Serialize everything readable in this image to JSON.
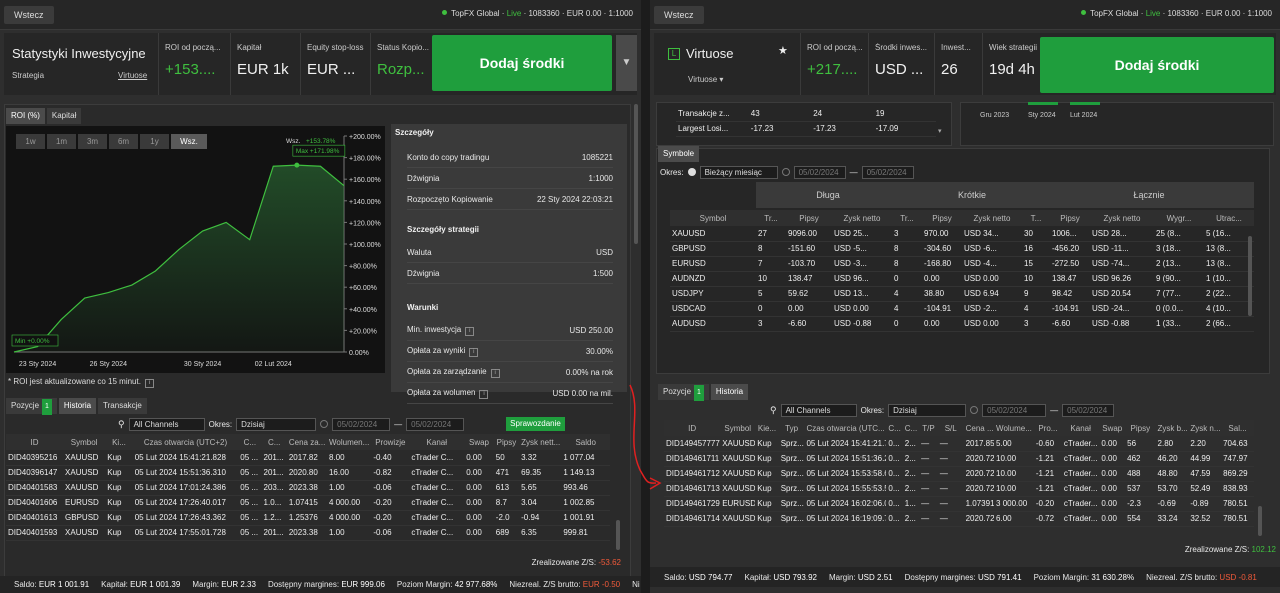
{
  "left": {
    "back_label": "Wstecz",
    "account": {
      "broker": "TopFX Global",
      "sep1": " · ",
      "live": "Live",
      "rest": " · 1083360 · EUR 0.00 · 1:1000"
    },
    "header": {
      "title": "Statystyki Inwestycyjne",
      "sub_label": "Strategia",
      "sub_value": "Virtuose",
      "kpis": [
        {
          "label": "ROI od począ...",
          "value": "+153...."
        },
        {
          "label": "Kapitał",
          "value": "EUR 1k"
        },
        {
          "label": "Equity stop-loss",
          "value": "EUR ..."
        },
        {
          "label": "Status Kopio...",
          "value": "Rozp..."
        }
      ],
      "add_funds": "Dodaj środki",
      "more_icon": "▼"
    },
    "chart_tabs": [
      "ROI (%)",
      "Kapitał"
    ],
    "periods": [
      "1w",
      "1m",
      "3m",
      "6m",
      "1y",
      "Wsz."
    ],
    "chart_data": {
      "type": "area",
      "x": [
        "2024-01-22",
        "2024-01-23",
        "2024-01-24",
        "2024-01-25",
        "2024-01-26",
        "2024-01-27",
        "2024-01-28",
        "2024-01-29",
        "2024-01-30",
        "2024-01-31",
        "2024-02-01",
        "2024-02-02",
        "2024-02-03",
        "2024-02-04",
        "2024-02-05"
      ],
      "values": [
        0,
        5,
        30,
        50,
        55,
        62,
        75,
        95,
        112,
        120,
        104,
        172,
        173,
        172,
        154
      ],
      "ylim": [
        0,
        200
      ],
      "yticks": [
        "+200.00%",
        "+180.00%",
        "+160.00%",
        "+140.00%",
        "+120.00%",
        "+100.00%",
        "+80.00%",
        "+60.00%",
        "+40.00%",
        "+20.00%",
        "0.00%"
      ],
      "xticks": [
        "23 Sty 2024",
        "26 Sty 2024",
        "30 Sty 2024",
        "02 Lut 2024"
      ],
      "max_label": "Max +171.98%",
      "min_label": "Min +0.00%",
      "all_label": "Wsz.",
      "all_value": "+153.78%"
    },
    "roi_note": "* ROI jest aktualizowane co 15 minut.",
    "details": {
      "title": "Szczegóły",
      "rows1": [
        {
          "k": "Konto do copy tradingu",
          "v": "1085221"
        },
        {
          "k": "Dźwignia",
          "v": "1:1000"
        },
        {
          "k": "Rozpoczęto Kopiowanie",
          "v": "22 Sty 2024 22:03:21"
        }
      ],
      "strategy_title": "Szczegóły strategii",
      "rows2": [
        {
          "k": "Waluta",
          "v": "USD"
        },
        {
          "k": "Dźwignia",
          "v": "1:500"
        }
      ],
      "conditions_title": "Warunki",
      "rows3": [
        {
          "k": "Min. inwestycja",
          "v": "USD 250.00"
        },
        {
          "k": "Opłata za wyniki",
          "v": "30.00%"
        },
        {
          "k": "Opłata za zarządzanie",
          "v": "0.00% na rok"
        },
        {
          "k": "Opłata za wolumen",
          "v": "USD 0.00 na mil."
        }
      ]
    },
    "bottom_tabs": [
      {
        "label": "Pozycje",
        "badge": "1"
      },
      {
        "label": "Historia"
      },
      {
        "label": "Transakcje"
      }
    ],
    "filter": {
      "channels": "All Channels",
      "okres": "Okres:",
      "period": "Dzisiaj",
      "from": "05/02/2024",
      "to": "05/02/2024",
      "verify": "Sprawozdanie"
    },
    "columns": [
      "ID",
      "Symbol",
      "Ki...",
      "Czas otwarcia (UTC+2)",
      "C...",
      "C...",
      "Cena za...",
      "Wolumen...",
      "Prowizje",
      "Kanał",
      "Swap",
      "Pipsy",
      "Zysk nett...",
      "Saldo"
    ],
    "rows": [
      [
        "DID40395216",
        "XAUUSD",
        "Kup",
        "05 Lut 2024 15:41:21.828",
        "05 ...",
        "201...",
        "2017.82",
        "8.00",
        "-0.40",
        "cTrader C...",
        "0.00",
        "50",
        "3.32",
        "1 077.04"
      ],
      [
        "DID40396147",
        "XAUUSD",
        "Kup",
        "05 Lut 2024 15:51:36.310",
        "05 ...",
        "201...",
        "2020.80",
        "16.00",
        "-0.82",
        "cTrader C...",
        "0.00",
        "471",
        "69.35",
        "1 149.13"
      ],
      [
        "DID40401583",
        "XAUUSD",
        "Kup",
        "05 Lut 2024 17:01:24.386",
        "05 ...",
        "203...",
        "2023.38",
        "1.00",
        "-0.06",
        "cTrader C...",
        "0.00",
        "613",
        "5.65",
        "993.46"
      ],
      [
        "DID40401606",
        "EURUSD",
        "Kup",
        "05 Lut 2024 17:26:40.017",
        "05 ...",
        "1.0...",
        "1.07415",
        "4 000.00",
        "-0.20",
        "cTrader C...",
        "0.00",
        "8.7",
        "3.04",
        "1 002.85"
      ],
      [
        "DID40401613",
        "GBPUSD",
        "Kup",
        "05 Lut 2024 17:26:43.362",
        "05 ...",
        "1.2...",
        "1.25376",
        "4 000.00",
        "-0.20",
        "cTrader C...",
        "0.00",
        "-2.0",
        "-0.94",
        "1 001.91"
      ],
      [
        "DID40401593",
        "XAUUSD",
        "Kup",
        "05 Lut 2024 17:55:01.728",
        "05 ...",
        "201...",
        "2023.38",
        "1.00",
        "-0.06",
        "cTrader C...",
        "0.00",
        "689",
        "6.35",
        "999.81"
      ]
    ],
    "realized": {
      "label": "Zrealizowane Z/S:",
      "value": "-53.62"
    },
    "footer": [
      {
        "k": "Saldo:",
        "v": "EUR 1 001.91"
      },
      {
        "k": "Kapitał:",
        "v": "EUR 1 001.39"
      },
      {
        "k": "Margin:",
        "v": "EUR 2.33"
      },
      {
        "k": "Dostępny margines:",
        "v": "EUR 999.06"
      },
      {
        "k": "Poziom Margin:",
        "v": "42 977.68%"
      },
      {
        "k": "Niezreal. Z/S brutto:",
        "v": "EUR -0.50"
      },
      {
        "k": "Ni",
        "v": ""
      }
    ]
  },
  "right": {
    "back_label": "Wstecz",
    "account": {
      "broker": "TopFX Global",
      "sep1": " · ",
      "live": "Live",
      "rest": " · 1083360 · EUR 0.00 · 1:1000"
    },
    "header": {
      "logo": "L",
      "title": "Virtuose",
      "sub": "Virtuose ▾",
      "star": "★",
      "kpis": [
        {
          "label": "ROI od począ...",
          "value": "+217...."
        },
        {
          "label": "Środki inwes...",
          "value": "USD ..."
        },
        {
          "label": "Inwest...",
          "value": "26"
        },
        {
          "label": "Wiek strategii",
          "value": "19d 4h"
        }
      ],
      "add_funds": "Dodaj środki"
    },
    "top_table": [
      [
        "Transakcje z...",
        "43",
        "24",
        "19"
      ],
      [
        "Largest Losi...",
        "-17.23",
        "-17.23",
        "-17.09"
      ]
    ],
    "mini_months": [
      "Gru 2023",
      "Sty 2024",
      "Lut 2024"
    ],
    "symbols_tab": "Symbole",
    "sym_filter": {
      "okres": "Okres:",
      "period": "Bieżący miesiąc",
      "from": "05/02/2024",
      "to": "05/02/2024"
    },
    "sym_groups": [
      "Długa",
      "Krótkie",
      "Łącznie"
    ],
    "sym_columns": [
      "Symbol",
      "Tr...",
      "Pipsy",
      "Zysk netto",
      "Tr...",
      "Pipsy",
      "Zysk netto",
      "T...",
      "Pipsy",
      "Zysk netto",
      "Wygr...",
      "Utrac..."
    ],
    "sym_rows": [
      [
        "XAUUSD",
        "27",
        "9096.00",
        "USD 25...",
        "3",
        "970.00",
        "USD 34...",
        "30",
        "1006...",
        "USD 28...",
        "25 (8...",
        "5 (16..."
      ],
      [
        "GBPUSD",
        "8",
        "-151.60",
        "USD -5...",
        "8",
        "-304.60",
        "USD -6...",
        "16",
        "-456.20",
        "USD -11...",
        "3 (18...",
        "13 (8..."
      ],
      [
        "EURUSD",
        "7",
        "-103.70",
        "USD -3...",
        "8",
        "-168.80",
        "USD -4...",
        "15",
        "-272.50",
        "USD -74...",
        "2 (13...",
        "13 (8..."
      ],
      [
        "AUDNZD",
        "10",
        "138.47",
        "USD 96...",
        "0",
        "0.00",
        "USD 0.00",
        "10",
        "138.47",
        "USD 96.26",
        "9 (90...",
        "1 (10..."
      ],
      [
        "USDJPY",
        "5",
        "59.62",
        "USD 13...",
        "4",
        "38.80",
        "USD 6.94",
        "9",
        "98.42",
        "USD 20.54",
        "7 (77...",
        "2 (22..."
      ],
      [
        "USDCAD",
        "0",
        "0.00",
        "USD 0.00",
        "4",
        "-104.91",
        "USD -2...",
        "4",
        "-104.91",
        "USD -24...",
        "0 (0.0...",
        "4 (10..."
      ],
      [
        "AUDUSD",
        "3",
        "-6.60",
        "USD -0.88",
        "0",
        "0.00",
        "USD 0.00",
        "3",
        "-6.60",
        "USD -0.88",
        "1 (33...",
        "2 (66..."
      ]
    ],
    "bottom_tabs": [
      {
        "label": "Pozycje",
        "badge": "1"
      },
      {
        "label": "Historia"
      }
    ],
    "filter": {
      "channels": "All Channels",
      "okres": "Okres:",
      "period": "Dzisiaj",
      "from": "05/02/2024",
      "to": "05/02/2024"
    },
    "columns": [
      "ID",
      "Symbol",
      "Kie...",
      "Typ",
      "Czas otwarcia (UTC...",
      "C...",
      "C...",
      "T/P",
      "S/L",
      "Cena ...",
      "Wolume...",
      "Pro...",
      "Kanał",
      "Swap",
      "Pipsy",
      "Zysk b...",
      "Zysk n...",
      "Sal..."
    ],
    "rows": [
      {
        "hl": false,
        "v": [
          "DID149457777",
          "XAUUSD",
          "Kup",
          "Sprz...",
          "05 Lut 2024 15:41:21.73905",
          "0...",
          "2...",
          "—",
          "—",
          "2017.85",
          "5.00",
          "-0.60",
          "cTrader...",
          "0.00",
          "56",
          "2.80",
          "2.20",
          "704.63"
        ]
      },
      {
        "hl": false,
        "v": [
          "DID149461711",
          "XAUUSD",
          "Kup",
          "Sprz...",
          "05 Lut 2024 15:51:36.25305",
          "0...",
          "2...",
          "—",
          "—",
          "2020.72",
          "10.00",
          "-1.21",
          "cTrader...",
          "0.00",
          "462",
          "46.20",
          "44.99",
          "747.97"
        ]
      },
      {
        "hl": true,
        "v": [
          "DID149461712",
          "XAUUSD",
          "Kup",
          "Sprz...",
          "05 Lut 2024 15:53:58.66405",
          "0...",
          "2...",
          "—",
          "—",
          "2020.72",
          "10.00",
          "-1.21",
          "cTrader...",
          "0.00",
          "488",
          "48.80",
          "47.59",
          "869.29"
        ]
      },
      {
        "hl": true,
        "v": [
          "DID149461713",
          "XAUUSD",
          "Kup",
          "Sprz...",
          "05 Lut 2024 15:55:53.51605",
          "0...",
          "2...",
          "—",
          "—",
          "2020.72",
          "10.00",
          "-1.21",
          "cTrader...",
          "0.00",
          "537",
          "53.70",
          "52.49",
          "838.93"
        ]
      },
      {
        "hl": true,
        "v": [
          "DID149461729",
          "EURUSD",
          "Kup",
          "Sprz...",
          "05 Lut 2024 16:02:06.00705",
          "0...",
          "1...",
          "—",
          "—",
          "1.07391",
          "3 000.00",
          "-0.20",
          "cTrader...",
          "0.00",
          "-2.3",
          "-0.69",
          "-0.89",
          "780.51"
        ]
      },
      {
        "hl": true,
        "v": [
          "DID149461714",
          "XAUUSD",
          "Kup",
          "Sprz...",
          "05 Lut 2024 16:19:09.74205",
          "0...",
          "2...",
          "—",
          "—",
          "2020.72",
          "6.00",
          "-0.72",
          "cTrader...",
          "0.00",
          "554",
          "33.24",
          "32.52",
          "780.51"
        ]
      }
    ],
    "realized": {
      "label": "Zrealizowane Z/S:",
      "value": "102.12"
    },
    "footer": [
      {
        "k": "Saldo:",
        "v": "USD 794.77"
      },
      {
        "k": "Kapitał:",
        "v": "USD 793.92"
      },
      {
        "k": "Margin:",
        "v": "USD 2.51"
      },
      {
        "k": "Dostępny margines:",
        "v": "USD 791.41"
      },
      {
        "k": "Poziom Margin:",
        "v": "31 630.28%"
      },
      {
        "k": "Niezreal. Z/S brutto:",
        "v": "USD -0.81"
      }
    ]
  },
  "colors": {
    "green": "#1f9e3d",
    "profit": "#3fbf3f",
    "loss": "#f05a3a",
    "highlight": "#ffee33",
    "annotation": "#e02020"
  }
}
